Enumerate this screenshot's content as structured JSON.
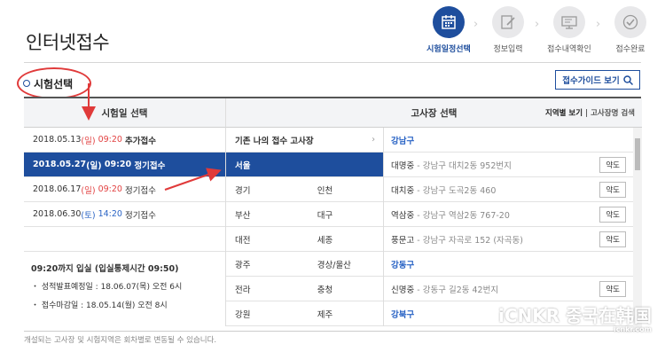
{
  "page": {
    "title": "인터넷접수"
  },
  "steps": [
    {
      "label": "시험일정선택",
      "icon": "calendar-icon",
      "active": true
    },
    {
      "label": "정보입력",
      "icon": "edit-icon",
      "active": false
    },
    {
      "label": "접수내역확인",
      "icon": "monitor-icon",
      "active": false
    },
    {
      "label": "접수완료",
      "icon": "check-icon",
      "active": false
    }
  ],
  "section": {
    "title": "시험선택",
    "guide_button": "접수가이드 보기"
  },
  "headers": {
    "date": "시험일 선택",
    "site": "고사장 선택",
    "filter_region": "지역별 보기",
    "filter_sep": "|",
    "filter_name": "고사장명 검색"
  },
  "dates": [
    {
      "date": "2018.05.13",
      "day": "(일)",
      "time": "09:20",
      "type": "추가접수",
      "selected": false
    },
    {
      "date": "2018.05.27",
      "day": "(일)",
      "time": "09:20",
      "type": "정기접수",
      "selected": true
    },
    {
      "date": "2018.06.17",
      "day": "(일)",
      "time": "09:20",
      "type": "정기접수",
      "selected": false
    },
    {
      "date": "2018.06.30",
      "day": "(토)",
      "time": "14:20",
      "type": "정기접수",
      "selected": false
    }
  ],
  "notice": {
    "title": "09:20까지 입실 (입실통제시간 09:50)",
    "line1": "・ 성적발표예정일 : 18.06.07(목) 오전 6시",
    "line2": "・ 접수마감일 : 18.05.14(월) 오전 8시"
  },
  "regions": {
    "previous": "기존 나의 접수 고사장",
    "seoul": "서울",
    "rows": [
      [
        "경기",
        "인천"
      ],
      [
        "부산",
        "대구"
      ],
      [
        "대전",
        "세종"
      ],
      [
        "광주",
        "경상/울산"
      ],
      [
        "전라",
        "충청"
      ],
      [
        "강원",
        "제주"
      ]
    ]
  },
  "sites": [
    {
      "kind": "region",
      "name": "강남구"
    },
    {
      "kind": "site",
      "name": "대명중",
      "addr": "- 강남구 대치2동 952번지",
      "btn": "약도"
    },
    {
      "kind": "site",
      "name": "대치중",
      "addr": "- 강남구 도곡2동 460",
      "btn": "약도"
    },
    {
      "kind": "site",
      "name": "역삼중",
      "addr": "- 강남구 역삼2동 767-20",
      "btn": "약도"
    },
    {
      "kind": "site",
      "name": "풍문고",
      "addr": "- 강남구 자곡로 152 (자곡동)",
      "btn": "약도"
    },
    {
      "kind": "region",
      "name": "강동구"
    },
    {
      "kind": "site",
      "name": "신명중",
      "addr": "- 강동구 길2동 42번지",
      "btn": "약도"
    },
    {
      "kind": "region",
      "name": "강북구"
    }
  ],
  "footer": "개설되는 고사장 및 시험지역은 회차별로 변동될 수 있습니다.",
  "watermark": {
    "brand": "iCNKR 중국在韩国",
    "url": "icnkr.com"
  },
  "colors": {
    "primary": "#1e4e9d",
    "accent_red": "#e24242",
    "annotation": "#e03a3a"
  }
}
